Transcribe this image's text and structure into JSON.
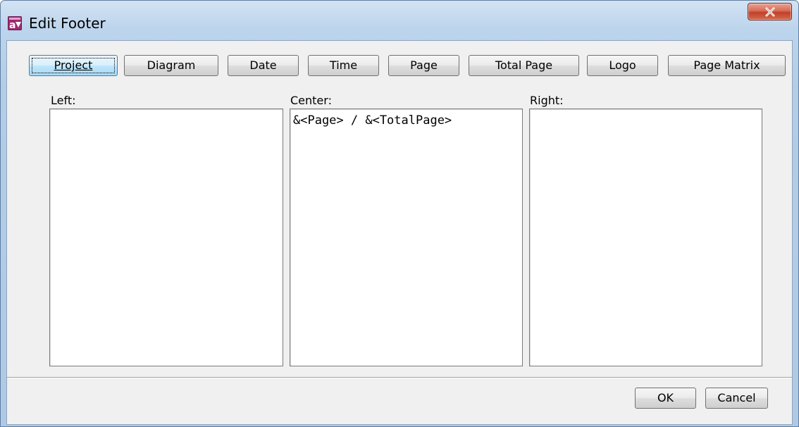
{
  "window": {
    "title": "Edit Footer",
    "close_label": "X",
    "app_icon": "astah-app-icon"
  },
  "toolbar": {
    "buttons": [
      {
        "label": "Project"
      },
      {
        "label": "Diagram"
      },
      {
        "label": "Date"
      },
      {
        "label": "Time"
      },
      {
        "label": "Page"
      },
      {
        "label": "Total Page"
      },
      {
        "label": "Logo"
      },
      {
        "label": "Page Matrix"
      }
    ]
  },
  "sections": {
    "left": {
      "label": "Left:",
      "value": ""
    },
    "center": {
      "label": "Center:",
      "value": "&<Page> / &<TotalPage>"
    },
    "right": {
      "label": "Right:",
      "value": ""
    }
  },
  "footer": {
    "ok_label": "OK",
    "cancel_label": "Cancel"
  }
}
